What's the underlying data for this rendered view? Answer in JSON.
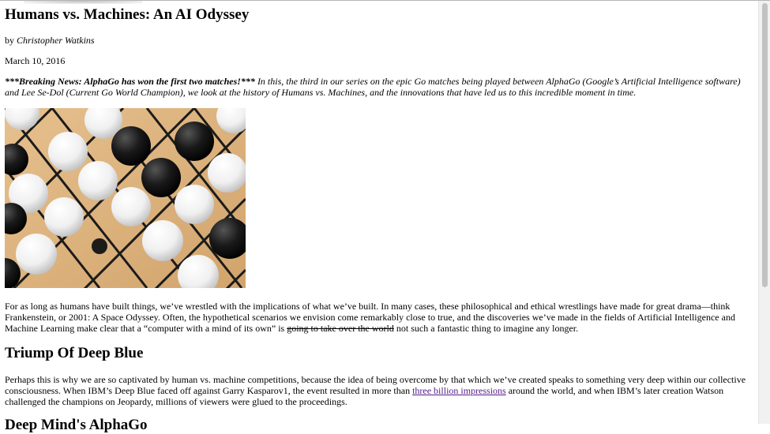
{
  "article": {
    "title": "Humans vs. Machines: An AI Odyssey",
    "byline_prefix": "by",
    "author": "Christopher Watkins",
    "date": "March 10, 2016",
    "lede_bold": "***Breaking News: AlphaGo has won the first two matches!***",
    "lede_text": " In this, the third in our series on the epic Go matches being played between AlphaGo (Google’s Artificial Intelligence software) and Lee Se-Dol (Current Go World Champion), we look at the history of Humans vs. Machines, and the innovations that have led us to this incredible moment in time.",
    "p1_a": "For as long as humans have built things, we’ve wrestled with the implications of what we’ve built. In many cases, these philosophical and ethical wrestlings have made for great drama—think Frankenstein, or 2001: A Space Odyssey. Often, the hypothetical scenarios we envision come remarkably close to true, and the discoveries we’ve made in the fields of Artificial Intelligence and Machine Learning make clear that a “computer with a mind of its own” is ",
    "p1_strike": "going to take over the world",
    "p1_b": " not such a fantastic thing to imagine any longer.",
    "section1_heading": "Triump Of Deep Blue",
    "p2_a": "Perhaps this is why we are so captivated by human vs. machine competitions, because the idea of being overcome by that which we’ve created speaks to something very deep within our collective consciousness. When IBM’s Deep Blue faced off against Garry Kasparov1, the event resulted in more than ",
    "p2_link": "three billion impressions",
    "p2_b": " around the world, and when IBM’s later creation Watson challenged the champions on Jeopardy, millions of viewers were glued to the proceedings.",
    "section2_heading": "Deep Mind's AlphaGo"
  },
  "image": {
    "icon": "go-board-photo"
  },
  "colors": {
    "link": "#551a8b",
    "board": "#d9b07a"
  }
}
